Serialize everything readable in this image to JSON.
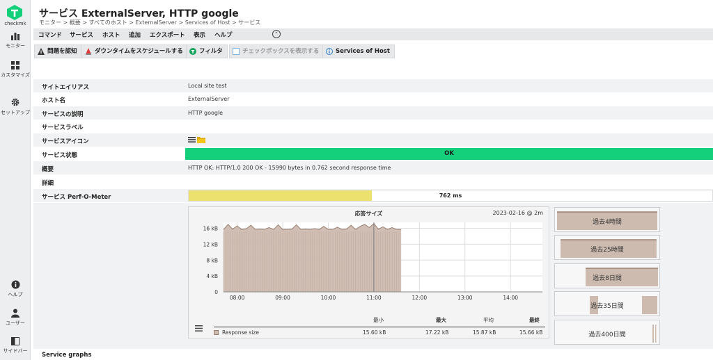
{
  "app": {
    "logo_text": "checkmk"
  },
  "nav": [
    {
      "id": "monitor",
      "label": "モニター",
      "icon": "bar-chart-icon"
    },
    {
      "id": "customize",
      "label": "カスタマイズ",
      "icon": "grid-icon"
    },
    {
      "id": "setup",
      "label": "セットアップ",
      "icon": "gear-icon"
    },
    {
      "id": "help",
      "label": "ヘルプ",
      "icon": "info-icon"
    },
    {
      "id": "user",
      "label": "ユーザー",
      "icon": "user-icon"
    },
    {
      "id": "sidebar",
      "label": "サイドバー",
      "icon": "sidebar-icon"
    }
  ],
  "header": {
    "title": "サービス ExternalServer, HTTP google",
    "breadcrumb": "モニター > 概要 > すべてのホスト > ExternalServer > Services of Host > サービス"
  },
  "menu": [
    "コマンド",
    "サービス",
    "ホスト",
    "追加",
    "エクスポート",
    "表示",
    "ヘルプ"
  ],
  "toolbar": {
    "acknowledge": "問題を認知",
    "downtime": "ダウンタイムをスケジュールする",
    "filter": "フィルタ",
    "checkboxes": "チェックボックスを表示する",
    "services_of_host": "Services of Host"
  },
  "details": {
    "site_alias": {
      "label": "サイトエイリアス",
      "value": "Local site test"
    },
    "host_name": {
      "label": "ホスト名",
      "value": "ExternalServer"
    },
    "service_desc": {
      "label": "サービスの説明",
      "value": "HTTP google"
    },
    "service_labels": {
      "label": "サービスラベル",
      "value": ""
    },
    "service_icons": {
      "label": "サービスアイコン"
    },
    "service_state": {
      "label": "サービス状態",
      "value": "OK"
    },
    "summary": {
      "label": "概要",
      "value": "HTTP OK: HTTP/1.0 200 OK - 15990 bytes in 0.762 second response time"
    },
    "details": {
      "label": "詳細",
      "value": ""
    },
    "perf_o_meter": {
      "label": "サービス Perf-O-Meter",
      "value": "762 ms",
      "fill_fraction": 0.35
    }
  },
  "colors": {
    "ok": "#15d07b",
    "perf": "#ece06e",
    "area": "#cdbbb0",
    "area_line": "#9a7f70"
  },
  "graph": {
    "title": "応答サイズ",
    "date": "2023-02-16 @ 2m",
    "legend": {
      "headers": [
        "最小",
        "最大",
        "平均",
        "最終"
      ],
      "series": "Response size",
      "min": "15.60 kB",
      "max": "17.22 kB",
      "avg": "15.87 kB",
      "last": "15.66 kB"
    }
  },
  "chart_data": {
    "type": "area",
    "title": "応答サイズ",
    "x_ticks": [
      "08:00",
      "09:00",
      "10:00",
      "11:00",
      "12:00",
      "13:00",
      "14:00"
    ],
    "y_ticks": [
      "0",
      "4 kB",
      "8 kB",
      "12 kB",
      "16 kB"
    ],
    "ylim": [
      0,
      17.5
    ],
    "x_hours": [
      7.7,
      7.8,
      7.9,
      8.0,
      8.1,
      8.2,
      8.3,
      8.4,
      8.5,
      8.6,
      8.7,
      8.8,
      8.9,
      9.0,
      9.1,
      9.2,
      9.3,
      9.4,
      9.5,
      9.6,
      9.7,
      9.8,
      9.9,
      10.0,
      10.1,
      10.2,
      10.3,
      10.4,
      10.5,
      10.6,
      10.7,
      10.8,
      10.9,
      11.0,
      11.1,
      11.2,
      11.3,
      11.4,
      11.5,
      11.6
    ],
    "values": [
      15.7,
      17.0,
      15.8,
      16.6,
      15.7,
      15.9,
      16.8,
      15.7,
      15.8,
      15.7,
      16.2,
      15.7,
      16.9,
      15.7,
      15.7,
      15.8,
      16.9,
      15.7,
      15.8,
      15.7,
      15.9,
      15.7,
      16.5,
      15.7,
      15.7,
      16.3,
      15.7,
      15.8,
      16.8,
      15.7,
      16.5,
      17.0,
      16.2,
      17.2,
      15.8,
      16.4,
      15.7,
      16.2,
      15.7,
      15.7
    ],
    "series": [
      {
        "name": "Response size"
      }
    ],
    "grid": true
  },
  "mini_graphs": [
    {
      "label": "過去4時間"
    },
    {
      "label": "過去25時間"
    },
    {
      "label": "過去8日間"
    },
    {
      "label": "過去35日間"
    },
    {
      "label": "過去400日間"
    }
  ],
  "section": {
    "service_graphs": "Service graphs"
  }
}
